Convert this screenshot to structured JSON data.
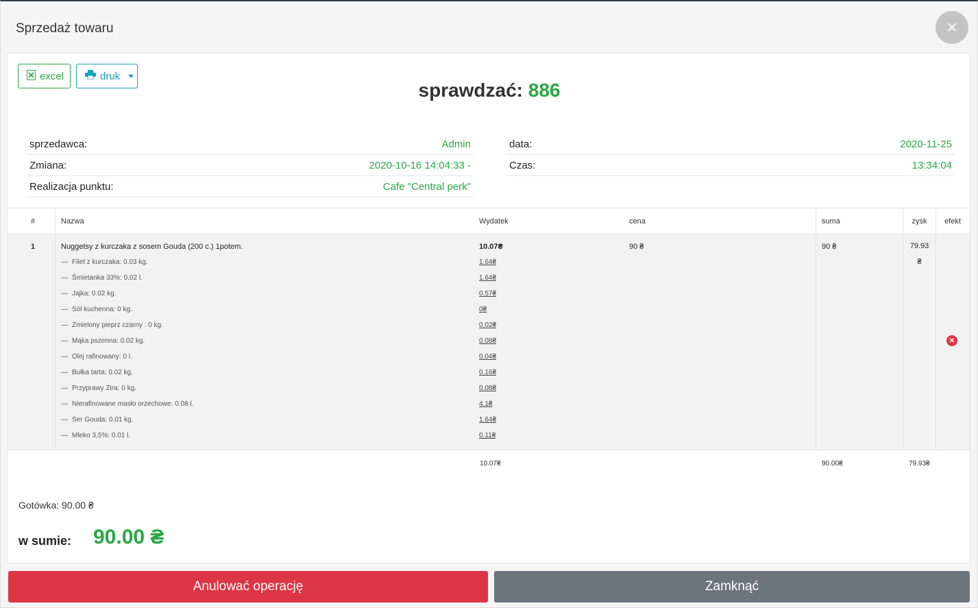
{
  "modal": {
    "title": "Sprzedaż towaru",
    "close_symbol": "×"
  },
  "toolbar": {
    "excel_label": "excel",
    "print_label": "druk",
    "excel_icon": "excel-file-icon",
    "print_icon": "printer-icon"
  },
  "check": {
    "label": "sprawdzać:",
    "number": "886"
  },
  "info_left": [
    {
      "label": "sprzedawca:",
      "value": "Admin"
    },
    {
      "label": "Zmiana:",
      "value": "2020-10-16 14:04:33 -"
    },
    {
      "label": "Realizacja punktu:",
      "value": "Cafe \"Central perk\""
    }
  ],
  "info_right": [
    {
      "label": "data:",
      "value": "2020-11-25"
    },
    {
      "label": "Czas:",
      "value": "13:34:04"
    }
  ],
  "table": {
    "headers": [
      "#",
      "Nazwa",
      "Wydatek",
      "cena",
      "suma",
      "zysk",
      "efekt"
    ],
    "row": {
      "index": "1",
      "name": "Nuggetsy z kurczaka z sosem Gouda (200 c.) 1potem.",
      "cost": "10.07₴",
      "price": "90 ₴",
      "sum": "90 ₴",
      "profit_line1": "79.93",
      "profit_line2": "₴",
      "ingredients": [
        {
          "name": "Filet z kurczaka: 0.03 kg.",
          "cost": "1.64₴"
        },
        {
          "name": "Śmietanka 33%: 0.02 l.",
          "cost": "1.64₴"
        },
        {
          "name": "Jajka: 0.02 kg.",
          "cost": "0.57₴"
        },
        {
          "name": "Sól kuchenna: 0 kg.",
          "cost": "0₴"
        },
        {
          "name": "Zmielony pieprz czarny : 0 kg.",
          "cost": "0.02₴"
        },
        {
          "name": "Mąka pszenna: 0.02 kg.",
          "cost": "0.08₴"
        },
        {
          "name": "Olej rafinowany: 0 l.",
          "cost": "0.04₴"
        },
        {
          "name": "Bułka tarta: 0.02 kg.",
          "cost": "0.16₴"
        },
        {
          "name": "Przyprawy Zira: 0 kg.",
          "cost": "0.08₴"
        },
        {
          "name": "Nierafinowane masło orzechowe: 0.08 l.",
          "cost": "4.1₴"
        },
        {
          "name": "Ser Gouda: 0.01 kg.",
          "cost": "1.64₴"
        },
        {
          "name": "Mleko 3,5%: 0.01 l.",
          "cost": "0.11₴"
        }
      ]
    },
    "totals": {
      "cost": "10.07₴",
      "sum": "90.00₴",
      "profit": "79.93₴"
    }
  },
  "payment": {
    "cash_label": "Gotówka: 90.00 ₴",
    "total_label": "w sumie:",
    "total_value": "90.00 ₴"
  },
  "footer": {
    "cancel_label": "Anulować operację",
    "close_label": "Zamknąć"
  },
  "colors": {
    "accent_green": "#28a745",
    "danger": "#dc3545",
    "secondary": "#6c757d",
    "info": "#17a2b8"
  }
}
